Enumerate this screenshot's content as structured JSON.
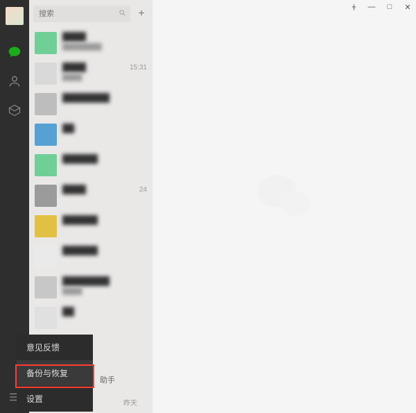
{
  "rail": {
    "icons": {
      "chat": "chat-bubble",
      "contacts": "contacts",
      "programs": "mini-programs",
      "menu": "hamburger"
    }
  },
  "search": {
    "placeholder": "搜索",
    "add_label": "+"
  },
  "conversations": [
    {
      "name": "████",
      "preview": "████████",
      "time": "",
      "thumb": "#6fcf97"
    },
    {
      "name": "████",
      "preview": "████",
      "time": "15:31",
      "thumb": "#d9d9d9"
    },
    {
      "name": "████████",
      "preview": "",
      "time": "",
      "thumb": "#bdbdbd"
    },
    {
      "name": "██-",
      "preview": "",
      "time": "",
      "thumb": "#56a0d3"
    },
    {
      "name": "██████",
      "preview": "",
      "time": "",
      "thumb": "#6fcf97"
    },
    {
      "name": "████",
      "preview": "",
      "time": "24",
      "thumb": "#9b9b9b"
    },
    {
      "name": "██████",
      "preview": "",
      "time": "",
      "thumb": "#e2c044"
    },
    {
      "name": "██████",
      "preview": "",
      "time": "",
      "thumb": "#eaeaea"
    },
    {
      "name": "████████",
      "preview": "████",
      "time": "",
      "thumb": "#c7c7c7"
    },
    {
      "name": "██",
      "preview": "",
      "time": "",
      "thumb": "#e0e0e0"
    }
  ],
  "menu": {
    "items": [
      "意见反馈",
      "备份与恢复",
      "设置"
    ],
    "highlighted_index": 1
  },
  "partial": {
    "helper_suffix": "助手",
    "day_suffix": "昨天"
  },
  "window_controls": {
    "pin": "⟊",
    "min": "—",
    "max": "□",
    "close": "✕"
  }
}
